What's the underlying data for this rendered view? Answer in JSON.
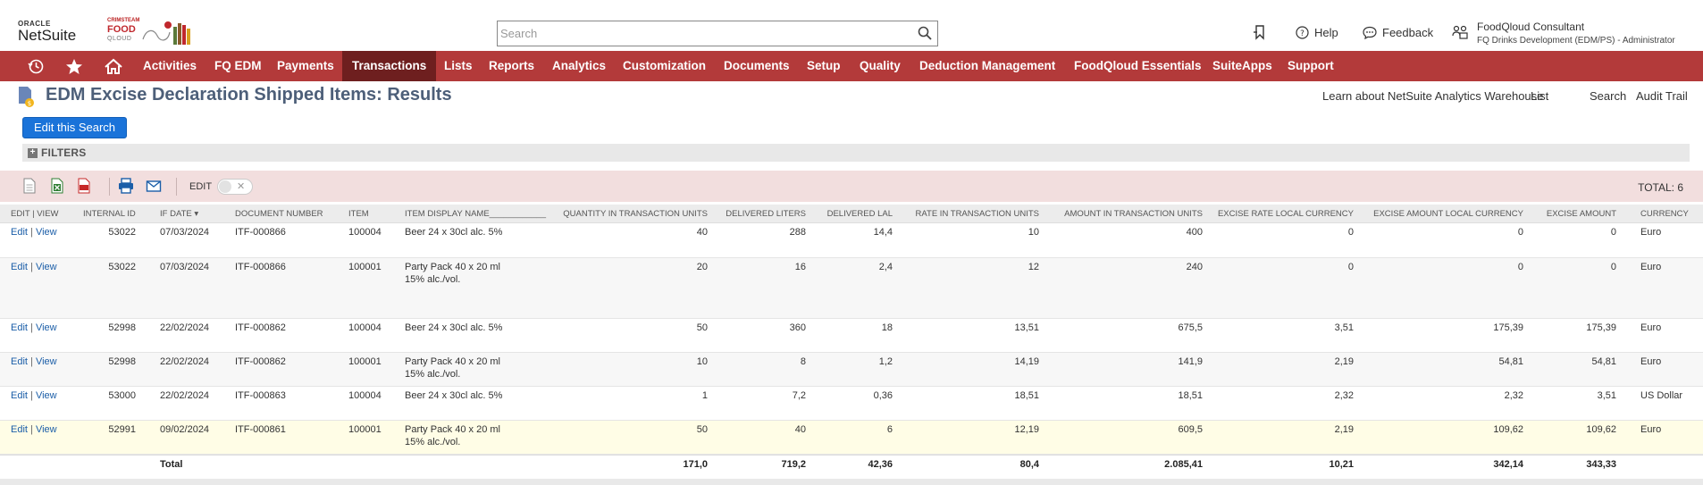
{
  "header": {
    "oracle_label": "ORACLE",
    "netsuite_label": "NetSuite",
    "partner_logo": {
      "line1": "CRIMSTEAM",
      "line2": "FOOD",
      "line3": "QLOUD"
    },
    "search_placeholder": "Search",
    "help_label": "Help",
    "feedback_label": "Feedback",
    "role_name": "FoodQloud Consultant",
    "role_detail": "FQ Drinks Development (EDM/PS) - Administrator"
  },
  "nav": {
    "items": [
      {
        "label": "Activities"
      },
      {
        "label": "FQ EDM"
      },
      {
        "label": "Payments"
      },
      {
        "label": "Transactions",
        "active": true
      },
      {
        "label": "Lists"
      },
      {
        "label": "Reports"
      },
      {
        "label": "Analytics"
      },
      {
        "label": "Customization"
      },
      {
        "label": "Documents"
      },
      {
        "label": "Setup"
      },
      {
        "label": "Quality"
      },
      {
        "label": "Deduction Management"
      },
      {
        "label": "FoodQloud Essentials"
      },
      {
        "label": "SuiteApps"
      },
      {
        "label": "Support"
      }
    ],
    "color": "#b33a3a",
    "active_color": "#6e1f1f"
  },
  "page": {
    "title": "EDM Excise Declaration Shipped Items: Results",
    "links": [
      "Learn about NetSuite Analytics Warehouse",
      "List",
      "Search",
      "Audit Trail"
    ],
    "edit_search_label": "Edit this Search",
    "filters_label": "FILTERS",
    "edit_toggle_label": "EDIT",
    "total_label": "TOTAL: 6"
  },
  "table": {
    "columns": [
      "EDIT | VIEW",
      "INTERNAL ID",
      "IF DATE ▾",
      "DOCUMENT NUMBER",
      "ITEM",
      "ITEM DISPLAY NAME____________",
      "QUANTITY IN TRANSACTION UNITS",
      "DELIVERED LITERS",
      "DELIVERED LAL",
      "RATE IN TRANSACTION UNITS",
      "AMOUNT IN TRANSACTION UNITS",
      "EXCISE RATE LOCAL CURRENCY",
      "EXCISE AMOUNT LOCAL CURRENCY",
      "EXCISE AMOUNT",
      "CURRENCY"
    ],
    "edit_label": "Edit",
    "view_label": "View",
    "rows": [
      {
        "id": "53022",
        "date": "07/03/2024",
        "doc": "ITF-000866",
        "item": "100004",
        "name": "Beer 24 x 30cl alc. 5%",
        "qty": "40",
        "liters": "288",
        "lal": "14,4",
        "rate": "10",
        "amount": "400",
        "excise_rate": "0",
        "excise_amt_local": "0",
        "excise_amt": "0",
        "currency": "Euro"
      },
      {
        "id": "53022",
        "date": "07/03/2024",
        "doc": "ITF-000866",
        "item": "100001",
        "name": "Party Pack 40 x 20 ml 15% alc./vol.",
        "qty": "20",
        "liters": "16",
        "lal": "2,4",
        "rate": "12",
        "amount": "240",
        "excise_rate": "0",
        "excise_amt_local": "0",
        "excise_amt": "0",
        "currency": "Euro"
      },
      {
        "id": "52998",
        "date": "22/02/2024",
        "doc": "ITF-000862",
        "item": "100004",
        "name": "Beer 24 x 30cl alc. 5%",
        "qty": "50",
        "liters": "360",
        "lal": "18",
        "rate": "13,51",
        "amount": "675,5",
        "excise_rate": "3,51",
        "excise_amt_local": "175,39",
        "excise_amt": "175,39",
        "currency": "Euro"
      },
      {
        "id": "52998",
        "date": "22/02/2024",
        "doc": "ITF-000862",
        "item": "100001",
        "name": "Party Pack 40 x 20 ml 15% alc./vol.",
        "qty": "10",
        "liters": "8",
        "lal": "1,2",
        "rate": "14,19",
        "amount": "141,9",
        "excise_rate": "2,19",
        "excise_amt_local": "54,81",
        "excise_amt": "54,81",
        "currency": "Euro"
      },
      {
        "id": "53000",
        "date": "22/02/2024",
        "doc": "ITF-000863",
        "item": "100004",
        "name": "Beer 24 x 30cl alc. 5%",
        "qty": "1",
        "liters": "7,2",
        "lal": "0,36",
        "rate": "18,51",
        "amount": "18,51",
        "excise_rate": "2,32",
        "excise_amt_local": "2,32",
        "excise_amt": "3,51",
        "currency": "US Dollar"
      },
      {
        "id": "52991",
        "date": "09/02/2024",
        "doc": "ITF-000861",
        "item": "100001",
        "name": "Party Pack 40 x 20 ml 15% alc./vol.",
        "qty": "50",
        "liters": "40",
        "lal": "6",
        "rate": "12,19",
        "amount": "609,5",
        "excise_rate": "2,19",
        "excise_amt_local": "109,62",
        "excise_amt": "109,62",
        "currency": "Euro"
      }
    ],
    "totals": {
      "label": "Total",
      "qty": "171,0",
      "liters": "719,2",
      "lal": "42,36",
      "rate": "80,4",
      "amount": "2.085,41",
      "excise_rate": "10,21",
      "excise_amt_local": "342,14",
      "excise_amt": "343,33"
    }
  }
}
